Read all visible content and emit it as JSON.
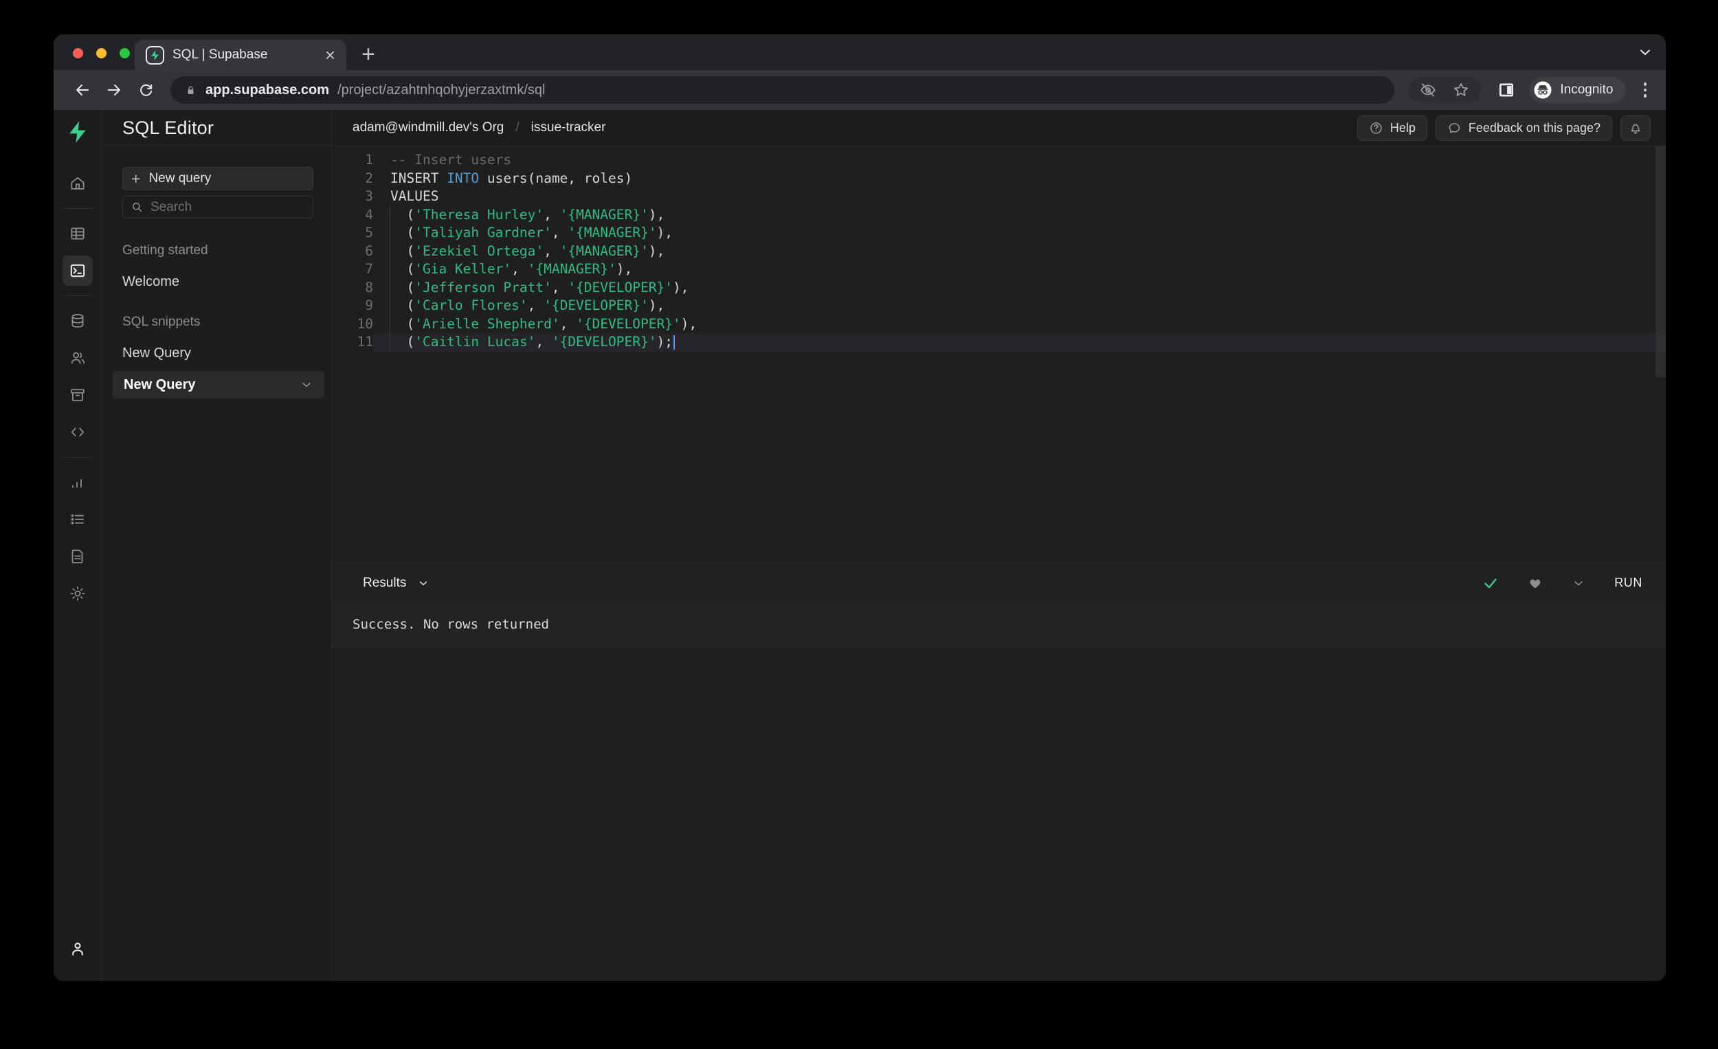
{
  "browser": {
    "tab_title": "SQL | Supabase",
    "url_host": "app.supabase.com",
    "url_path": "/project/azahtnhqohyjerzaxtmk/sql",
    "incognito_label": "Incognito"
  },
  "panel": {
    "title": "SQL Editor",
    "new_query_button": "New query",
    "search_placeholder": "Search",
    "section_getting_started": "Getting started",
    "item_welcome": "Welcome",
    "section_sql_snippets": "SQL snippets",
    "item_new_query": "New Query",
    "active_item_new_query": "New Query"
  },
  "header": {
    "org": "adam@windmill.dev's Org",
    "separator": "/",
    "project": "issue-tracker",
    "help": "Help",
    "feedback": "Feedback on this page?"
  },
  "editor": {
    "lines": [
      {
        "num": "1",
        "parts": [
          {
            "text": "-- Insert users",
            "type": "comment"
          }
        ]
      },
      {
        "num": "2",
        "parts": [
          {
            "text": "INSERT ",
            "type": "plain"
          },
          {
            "text": "INTO",
            "type": "keyword"
          },
          {
            "text": " users(name, roles)",
            "type": "plain"
          }
        ]
      },
      {
        "num": "3",
        "parts": [
          {
            "text": "VALUES",
            "type": "plain"
          }
        ]
      },
      {
        "num": "4",
        "parts": [
          {
            "text": "  (",
            "type": "plain"
          },
          {
            "text": "'Theresa Hurley'",
            "type": "string"
          },
          {
            "text": ", ",
            "type": "plain"
          },
          {
            "text": "'{MANAGER}'",
            "type": "string"
          },
          {
            "text": "),",
            "type": "plain"
          }
        ]
      },
      {
        "num": "5",
        "parts": [
          {
            "text": "  (",
            "type": "plain"
          },
          {
            "text": "'Taliyah Gardner'",
            "type": "string"
          },
          {
            "text": ", ",
            "type": "plain"
          },
          {
            "text": "'{MANAGER}'",
            "type": "string"
          },
          {
            "text": "),",
            "type": "plain"
          }
        ]
      },
      {
        "num": "6",
        "parts": [
          {
            "text": "  (",
            "type": "plain"
          },
          {
            "text": "'Ezekiel Ortega'",
            "type": "string"
          },
          {
            "text": ", ",
            "type": "plain"
          },
          {
            "text": "'{MANAGER}'",
            "type": "string"
          },
          {
            "text": "),",
            "type": "plain"
          }
        ]
      },
      {
        "num": "7",
        "parts": [
          {
            "text": "  (",
            "type": "plain"
          },
          {
            "text": "'Gia Keller'",
            "type": "string"
          },
          {
            "text": ", ",
            "type": "plain"
          },
          {
            "text": "'{MANAGER}'",
            "type": "string"
          },
          {
            "text": "),",
            "type": "plain"
          }
        ]
      },
      {
        "num": "8",
        "parts": [
          {
            "text": "  (",
            "type": "plain"
          },
          {
            "text": "'Jefferson Pratt'",
            "type": "string"
          },
          {
            "text": ", ",
            "type": "plain"
          },
          {
            "text": "'{DEVELOPER}'",
            "type": "string"
          },
          {
            "text": "),",
            "type": "plain"
          }
        ]
      },
      {
        "num": "9",
        "parts": [
          {
            "text": "  (",
            "type": "plain"
          },
          {
            "text": "'Carlo Flores'",
            "type": "string"
          },
          {
            "text": ", ",
            "type": "plain"
          },
          {
            "text": "'{DEVELOPER}'",
            "type": "string"
          },
          {
            "text": "),",
            "type": "plain"
          }
        ]
      },
      {
        "num": "10",
        "parts": [
          {
            "text": "  (",
            "type": "plain"
          },
          {
            "text": "'Arielle Shepherd'",
            "type": "string"
          },
          {
            "text": ", ",
            "type": "plain"
          },
          {
            "text": "'{DEVELOPER}'",
            "type": "string"
          },
          {
            "text": "),",
            "type": "plain"
          }
        ]
      },
      {
        "num": "11",
        "parts": [
          {
            "text": "  (",
            "type": "plain"
          },
          {
            "text": "'Caitlin Lucas'",
            "type": "string"
          },
          {
            "text": ", ",
            "type": "plain"
          },
          {
            "text": "'{DEVELOPER}'",
            "type": "string"
          },
          {
            "text": ");",
            "type": "plain"
          }
        ]
      }
    ]
  },
  "results": {
    "label": "Results",
    "run": "RUN",
    "message": "Success. No rows returned"
  },
  "colors": {
    "accent_green": "#3ECF8E",
    "keyword_blue": "#569CD6",
    "string_green": "#2EBD85",
    "comment_gray": "#6A6A6A",
    "cursor_blue": "#4F8FF7"
  }
}
